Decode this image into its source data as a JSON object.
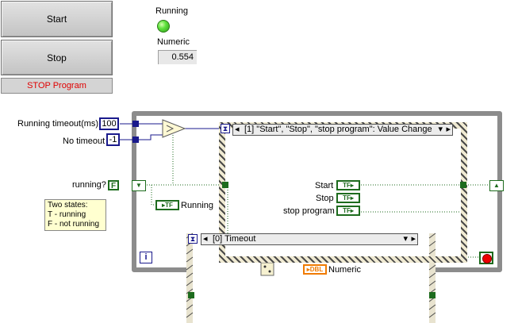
{
  "front_panel": {
    "start_label": "Start",
    "stop_label": "Stop",
    "stop_program_label": "STOP Program",
    "running_label": "Running",
    "numeric_label": "Numeric",
    "numeric_value": "0.554"
  },
  "block_diagram": {
    "running_timeout_label": "Running timeout(ms)",
    "running_timeout_value": "100",
    "no_timeout_label": "No timeout",
    "no_timeout_value": "-1",
    "running_q_label": "running?",
    "running_q_value": "F",
    "running_local_label": "Running",
    "note_text": [
      "Two states:",
      "T - running",
      "F - not running"
    ],
    "event_case_selector": "[1] \"Start\", \"Stop\", \"stop program\": Value Change",
    "event_terms": [
      "Start",
      "Stop",
      "stop program"
    ],
    "timeout_case_selector": "[0] Timeout",
    "numeric_term_label": "Numeric",
    "tf_text": "TF",
    "dbl_text": "DBL",
    "iteration_label": "i"
  },
  "colors": {
    "led_on": "#3fcf2a",
    "stop_program_text": "#e00000",
    "boolean_wire": "#1d6b1d",
    "numeric_wire": "#1a1a8c",
    "dbl_wire": "#f07b00"
  }
}
